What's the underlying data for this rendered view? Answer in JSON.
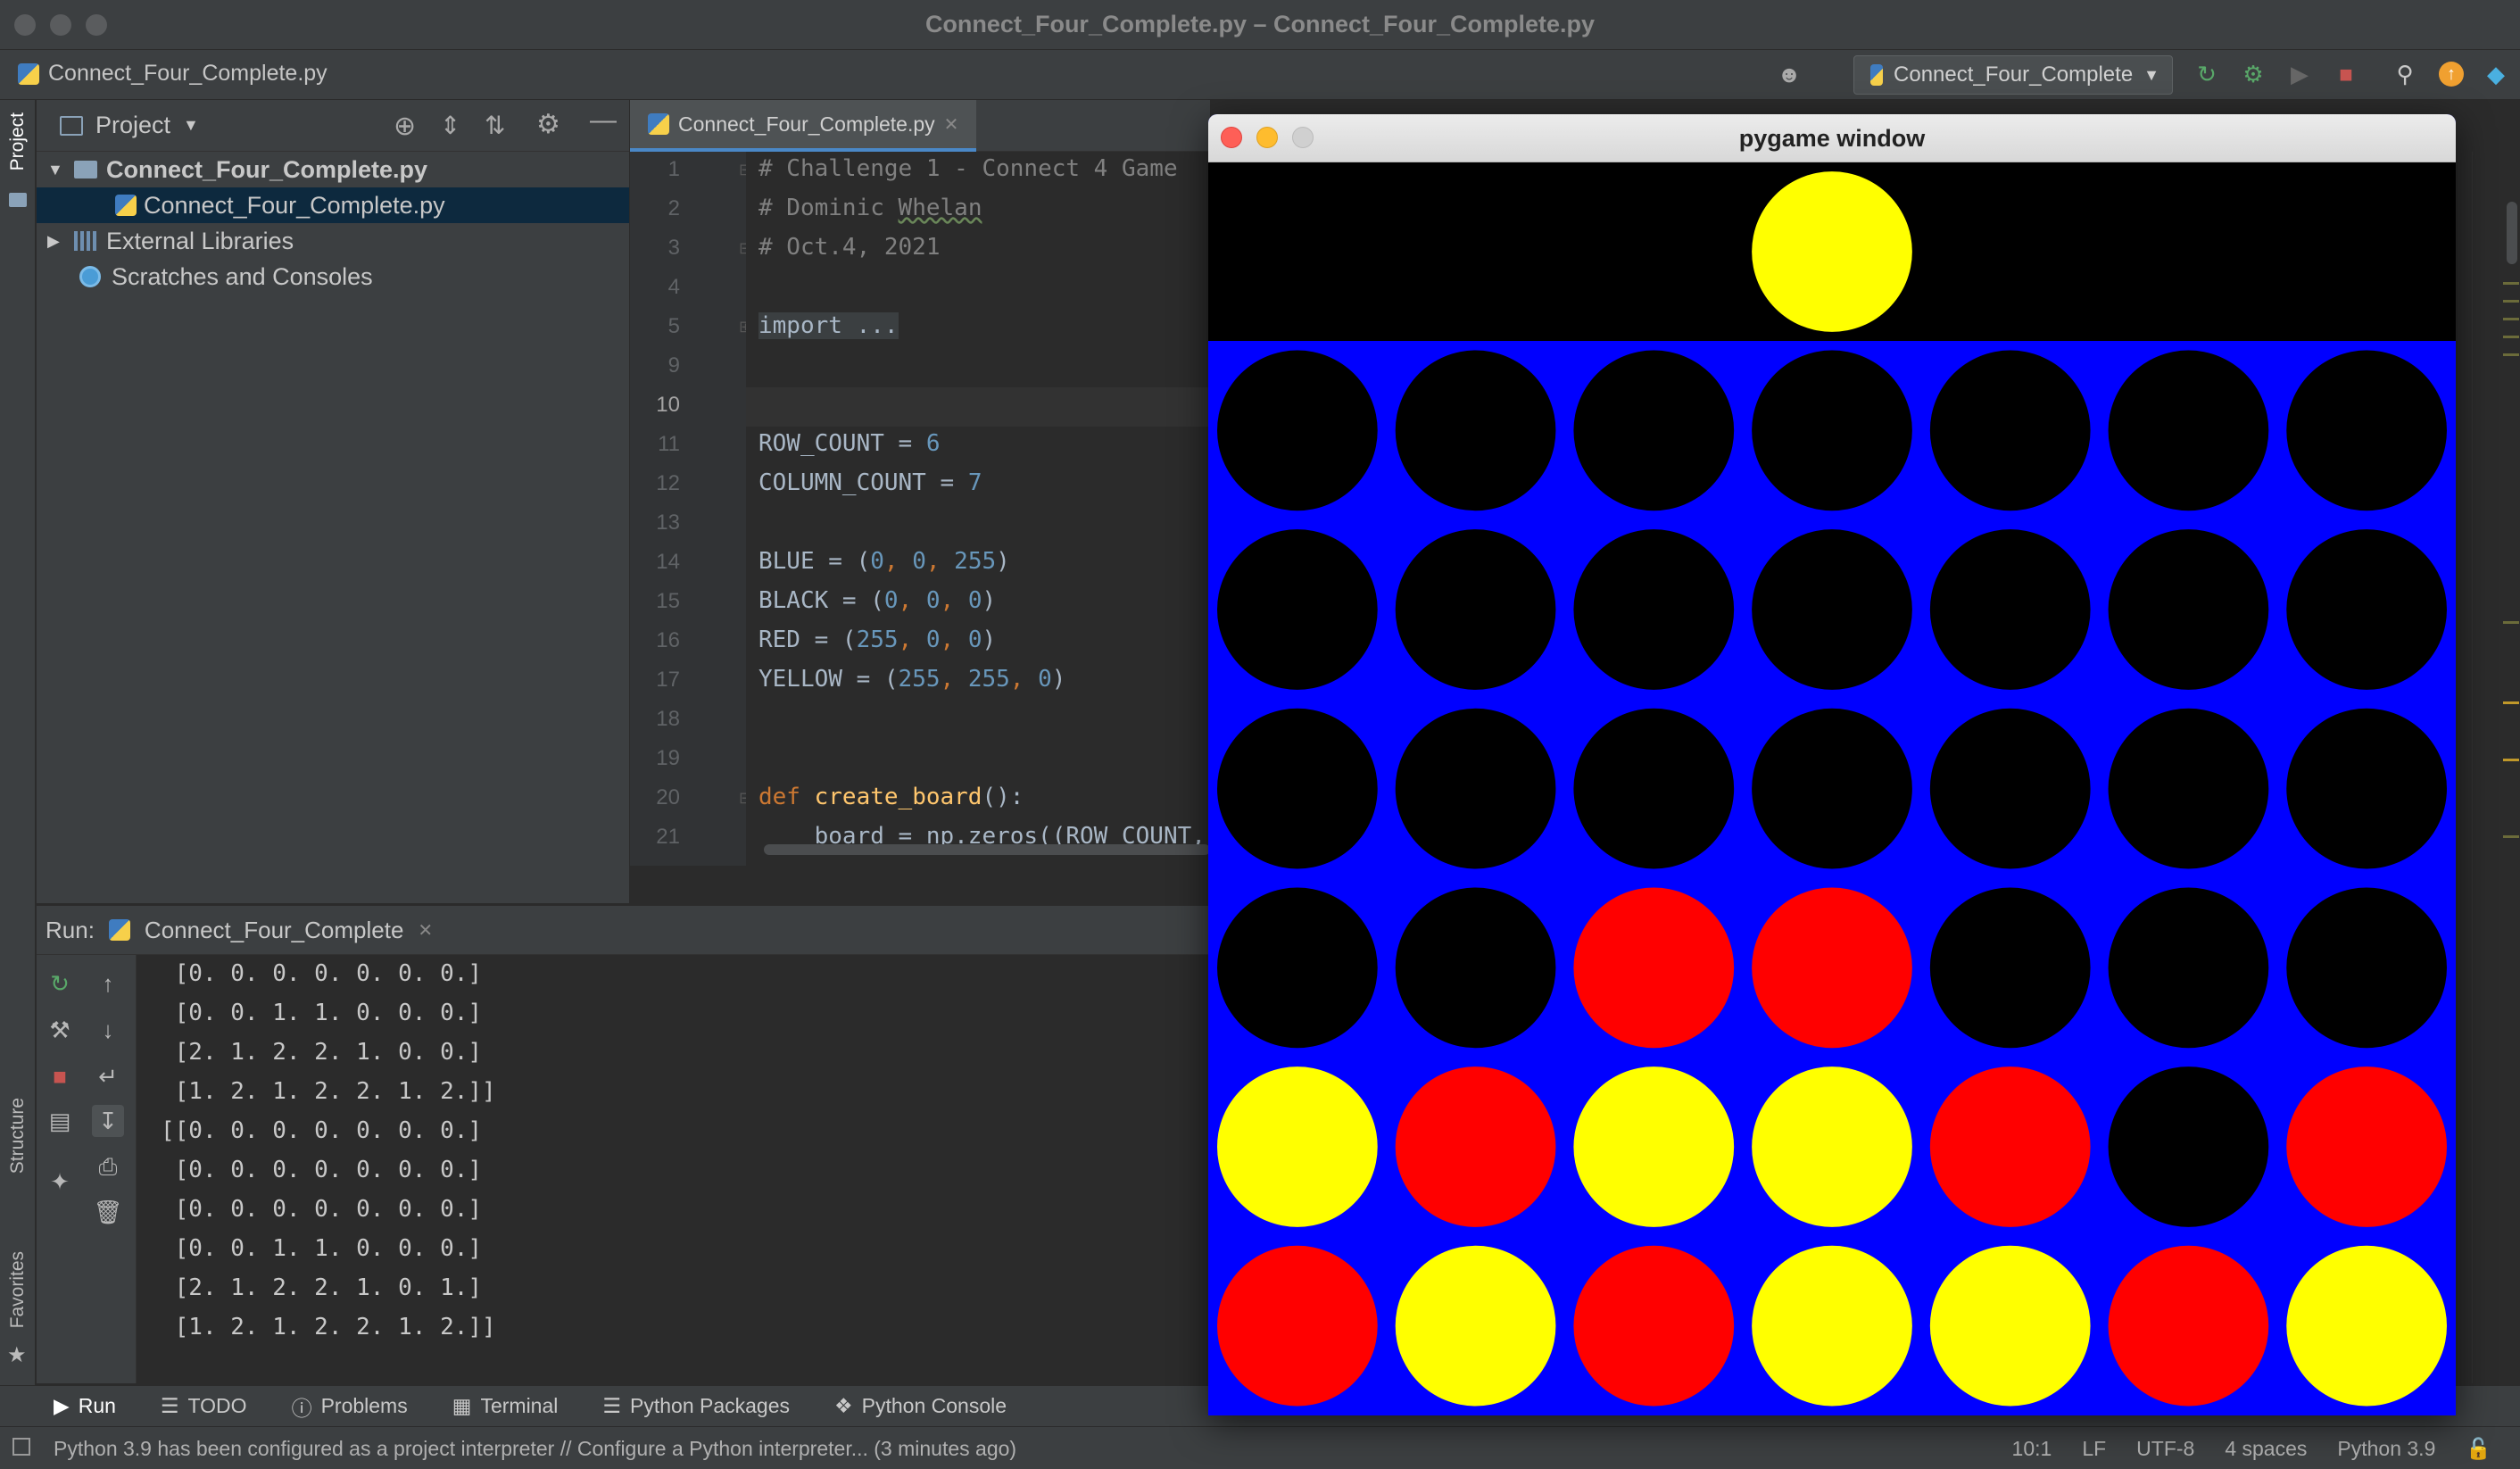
{
  "window": {
    "title": "Connect_Four_Complete.py – Connect_Four_Complete.py"
  },
  "navbar": {
    "file": "Connect_Four_Complete.py",
    "run_config": "Connect_Four_Complete"
  },
  "left_strip": {
    "project": "Project",
    "structure": "Structure",
    "favorites": "Favorites"
  },
  "project": {
    "title": "Project",
    "tree": [
      {
        "label": "Connect_Four_Complete.py",
        "bold": true
      },
      {
        "label": "Connect_Four_Complete.py",
        "selected": true
      },
      {
        "label": "External Libraries"
      },
      {
        "label": "Scratches and Consoles"
      }
    ]
  },
  "editor": {
    "tab": "Connect_Four_Complete.py",
    "line_numbers": [
      "1",
      "2",
      "3",
      "4",
      "5",
      "9",
      "10",
      "11",
      "12",
      "13",
      "14",
      "15",
      "16",
      "17",
      "18",
      "19",
      "20",
      "21"
    ],
    "current_line": "10",
    "lines": {
      "l1": "# Challenge 1 - Connect 4 Game",
      "l2_prefix": "# Dominic ",
      "l2_name": "Whelan",
      "l3": "# Oct.4, 2021",
      "l5": "import ...",
      "l11_a": "ROW_COUNT = ",
      "l11_n": "6",
      "l12_a": "COLUMN_COUNT = ",
      "l12_n": "7",
      "l14_a": "BLUE = (",
      "l14_n1": "0",
      "l14_n2": "0",
      "l14_n3": "255",
      "l15_a": "BLACK = (",
      "l15_n1": "0",
      "l15_n2": "0",
      "l15_n3": "0",
      "l16_a": "RED = (",
      "l16_n1": "255",
      "l16_n2": "0",
      "l16_n3": "0",
      "l17_a": "YELLOW = (",
      "l17_n1": "255",
      "l17_n2": "255",
      "l17_n3": "0",
      "l20_kw": "def ",
      "l20_fn": "create_board",
      "l20_rest": "():",
      "l21": "    board = np.zeros((ROW_COUNT, C"
    }
  },
  "run": {
    "label": "Run:",
    "tab": "Connect_Four_Complete",
    "output": [
      " [0. 0. 0. 0. 0. 0. 0.]",
      " [0. 0. 1. 1. 0. 0. 0.]",
      " [2. 1. 2. 2. 1. 0. 0.]",
      " [1. 2. 1. 2. 2. 1. 2.]]",
      "[[0. 0. 0. 0. 0. 0. 0.]",
      " [0. 0. 0. 0. 0. 0. 0.]",
      " [0. 0. 0. 0. 0. 0. 0.]",
      " [0. 0. 1. 1. 0. 0. 0.]",
      " [2. 1. 2. 2. 1. 0. 1.]",
      " [1. 2. 1. 2. 2. 1. 2.]]"
    ]
  },
  "tool_tabs": [
    "Run",
    "TODO",
    "Problems",
    "Terminal",
    "Python Packages",
    "Python Console"
  ],
  "status": {
    "message": "Python 3.9 has been configured as a project interpreter // Configure a Python interpreter... (3 minutes ago)",
    "position": "10:1",
    "line_sep": "LF",
    "encoding": "UTF-8",
    "indent": "4 spaces",
    "interpreter": "Python 3.9"
  },
  "pygame": {
    "title": "pygame window",
    "colors": {
      "blue": "#0000ff",
      "black": "#000000",
      "red": "#ff0000",
      "yellow": "#ffff00"
    },
    "hover_piece": {
      "column": 3,
      "color": "yellow"
    },
    "rows": 6,
    "columns": 7,
    "board": [
      [
        0,
        0,
        0,
        0,
        0,
        0,
        0
      ],
      [
        0,
        0,
        0,
        0,
        0,
        0,
        0
      ],
      [
        0,
        0,
        0,
        0,
        0,
        0,
        0
      ],
      [
        0,
        0,
        1,
        1,
        0,
        0,
        0
      ],
      [
        2,
        1,
        2,
        2,
        1,
        0,
        1
      ],
      [
        1,
        2,
        1,
        2,
        2,
        1,
        2
      ]
    ]
  }
}
